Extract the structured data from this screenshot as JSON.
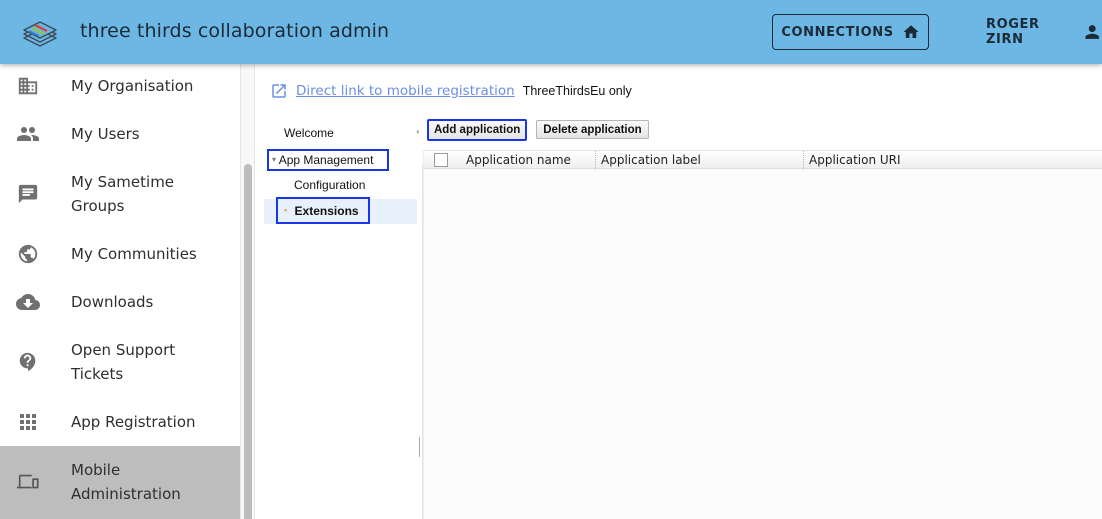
{
  "header": {
    "title": "three thirds collaboration admin",
    "logo_icon": "layers-stack-logo",
    "connections_label": "CONNECTIONS",
    "connections_icon": "home-icon",
    "user_label": "ROGER ZIRN",
    "user_icon": "person-icon",
    "bg_color": "#6db7e4"
  },
  "sidebar": {
    "items": [
      {
        "label": "My Organisation",
        "icon": "building-icon"
      },
      {
        "label": "My Users",
        "icon": "people-icon"
      },
      {
        "label": "My Sametime Groups",
        "icon": "chat-icon"
      },
      {
        "label": "My Communities",
        "icon": "globe-icon"
      },
      {
        "label": "Downloads",
        "icon": "cloud-download-icon"
      },
      {
        "label": "Open Support Tickets",
        "icon": "help-icon"
      },
      {
        "label": "App Registration",
        "icon": "apps-grid-icon"
      },
      {
        "label": "Mobile Administration",
        "icon": "devices-icon",
        "active": true
      }
    ]
  },
  "main": {
    "direct_link": {
      "icon": "open-in-new-icon",
      "label": "Direct link to mobile registration",
      "note": "ThreeThirdsEu only"
    },
    "tree": {
      "items": [
        {
          "label": "Welcome",
          "level": 0
        },
        {
          "label": "App Management",
          "level": 0,
          "expanded": true,
          "expander": "▾"
        },
        {
          "label": "Configuration",
          "level": 1
        },
        {
          "label": "Extensions",
          "level": 1,
          "selected": true,
          "bullet": "▪"
        }
      ]
    },
    "toolbar": {
      "add_label": "Add application",
      "delete_label": "Delete application"
    },
    "grid": {
      "columns": [
        "Application name",
        "Application label",
        "Application URI"
      ],
      "rows": []
    }
  }
}
